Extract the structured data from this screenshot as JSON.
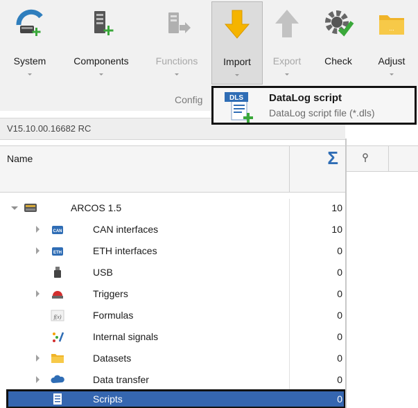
{
  "ribbon": {
    "buttons": [
      {
        "label": "System",
        "icon": "system-add-icon",
        "enabled": true
      },
      {
        "label": "Components",
        "icon": "components-add-icon",
        "enabled": true
      },
      {
        "label": "Functions",
        "icon": "functions-icon",
        "enabled": false
      },
      {
        "label": "Import",
        "icon": "import-arrow-icon",
        "enabled": true
      },
      {
        "label": "Export",
        "icon": "export-arrow-icon",
        "enabled": false
      },
      {
        "label": "Check",
        "icon": "check-gear-icon",
        "enabled": true
      },
      {
        "label": "Adjust",
        "icon": "adjust-folder-icon",
        "enabled": true
      }
    ],
    "group_label": "Config"
  },
  "import_menu": {
    "badge": "DLS",
    "title": "DataLog script",
    "subtitle": "DataLog script file (*.dls)"
  },
  "version": "V15.10.00.16682 RC",
  "tree": {
    "header_name": "Name",
    "header_sum": "Σ",
    "rows": [
      {
        "label": "ARCOS 1.5",
        "count": "10",
        "icon": "device-icon"
      },
      {
        "label": "CAN interfaces",
        "count": "10",
        "icon": "can-icon",
        "badge": "CAN"
      },
      {
        "label": "ETH interfaces",
        "count": "0",
        "icon": "eth-icon",
        "badge": "ETH"
      },
      {
        "label": "USB",
        "count": "0",
        "icon": "usb-icon"
      },
      {
        "label": "Triggers",
        "count": "0",
        "icon": "trigger-icon"
      },
      {
        "label": "Formulas",
        "count": "0",
        "icon": "formula-icon",
        "badge": "f(x)"
      },
      {
        "label": "Internal signals",
        "count": "0",
        "icon": "internal-signals-icon"
      },
      {
        "label": "Datasets",
        "count": "0",
        "icon": "folder-icon"
      },
      {
        "label": "Data transfer",
        "count": "0",
        "icon": "cloud-icon"
      },
      {
        "label": "Scripts",
        "count": "0",
        "icon": "script-icon"
      }
    ]
  },
  "colors": {
    "selection": "#3566b0",
    "accent_blue": "#2f6db5",
    "ribbon_bg": "#f1f1f1"
  }
}
